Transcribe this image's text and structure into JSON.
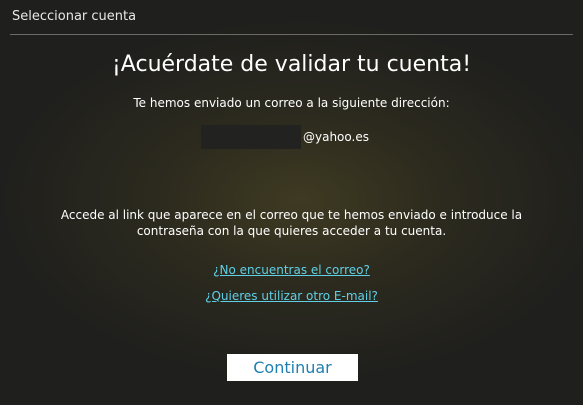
{
  "window": {
    "title": "Seleccionar cuenta"
  },
  "main": {
    "heading": "¡Acuérdate de validar tu cuenta!",
    "sent_text": "Te hemos enviado un correo a la siguiente dirección:",
    "email_domain": "@yahoo.es",
    "instructions": "Accede al link que aparece en el correo que te hemos enviado e introduce la contraseña con la que quieres acceder a tu cuenta.",
    "links": [
      {
        "label": "¿No encuentras el correo?"
      },
      {
        "label": "¿Quieres utilizar otro E-mail?"
      }
    ],
    "continue_label": "Continuar"
  },
  "colors": {
    "link": "#5fd0e6",
    "button_text": "#1f7fb0",
    "background": "#2d2b1e"
  }
}
